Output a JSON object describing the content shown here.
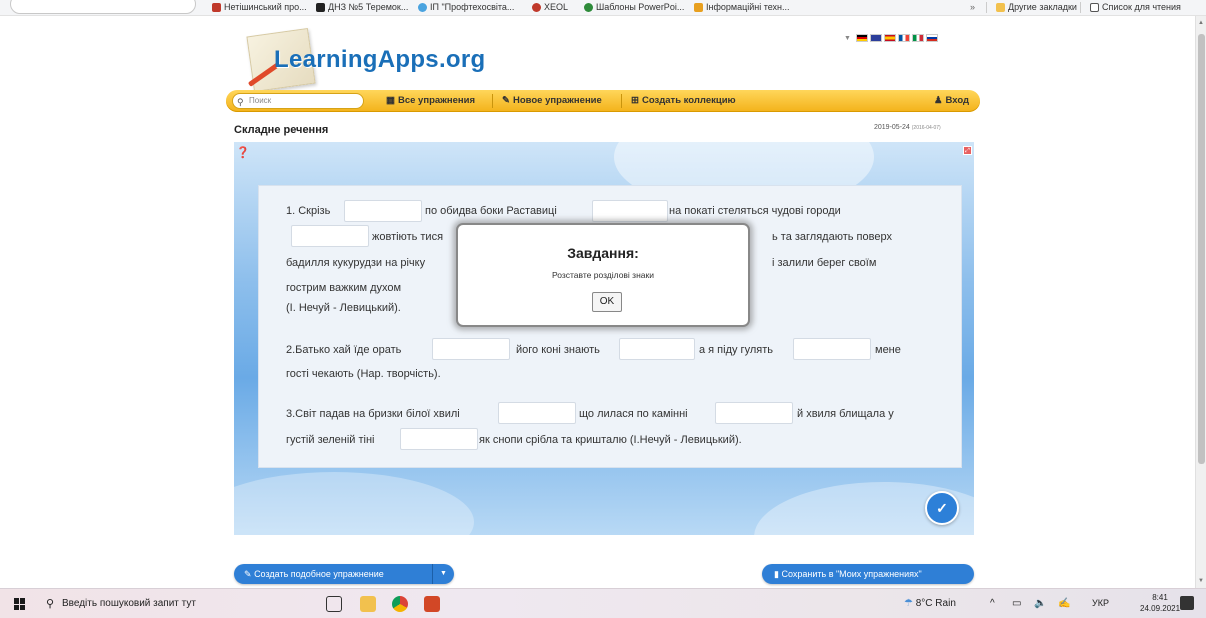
{
  "bookmarks": {
    "items": [
      {
        "label": "Нетішинський про...",
        "icon_color": "#c0392b"
      },
      {
        "label": "ДНЗ №5 Теремок...",
        "icon_color": "#222222"
      },
      {
        "label": "ІП \"Профтехосвіта...",
        "icon_color": "#4aa3df"
      },
      {
        "label": "XEOL",
        "icon_color": "#c0392b"
      },
      {
        "label": "Шаблоны PowerPoi...",
        "icon_color": "#2e8b3a"
      },
      {
        "label": "Інформаційні техн...",
        "icon_color": "#e8a020"
      }
    ],
    "more": "»",
    "other_bookmarks": "Другие закладки",
    "reading_list": "Список для чтения"
  },
  "header": {
    "logo_text": "LearningApps.org",
    "flags": [
      "#c0392b",
      "#2c3e9b",
      "#f1c40f",
      "#3f8fd9",
      "#2e8b3a",
      "#e0e0ff"
    ]
  },
  "nav": {
    "search_placeholder": "Поиск",
    "all_exercises": "Все упражнения",
    "new_exercise": "Новое упражнение",
    "create_collection": "Создать коллекцию",
    "login": "Вход"
  },
  "page": {
    "title": "Складне речення",
    "date": "2019-05-24",
    "date_small": "(2016-04-07)"
  },
  "exercise": {
    "s1": {
      "a": "1. Скрізь",
      "b": "по обидва боки Раставиці",
      "c": "на покаті стеляться чудові городи",
      "d": "жовтіють тися",
      "e": "ь та заглядають поверх",
      "f": "бадилля кукурудзи на річку",
      "g": "і залили берег своїм",
      "h": "гострим важким духом",
      "i": "(І. Нечуй - Левицький)."
    },
    "s2": {
      "a": "2.Батько хай їде орать",
      "b": "його коні знають",
      "c": "а я піду гулять",
      "d": "мене",
      "e": "гості чекають (Нар. творчість)."
    },
    "s3": {
      "a": "3.Світ падав на бризки білої хвилі",
      "b": "що лилася по камінні",
      "c": "й хвиля блищала у",
      "d": "густій зеленій тіні",
      "e": "як снопи срібла та кришталю (І.Нечуй - Левицький)."
    }
  },
  "modal": {
    "title": "Завдання:",
    "body": "Розставте розділові знаки",
    "ok": "OK"
  },
  "footer": {
    "create_similar": "Создать подобное упражнение",
    "save": "Сохранить в \"Моих упражнениях\""
  },
  "taskbar": {
    "search_placeholder": "Введіть пошуковий запит тут",
    "weather": "8°C Rain",
    "lang": "УКР",
    "time": "8:41",
    "date": "24.09.2021"
  }
}
